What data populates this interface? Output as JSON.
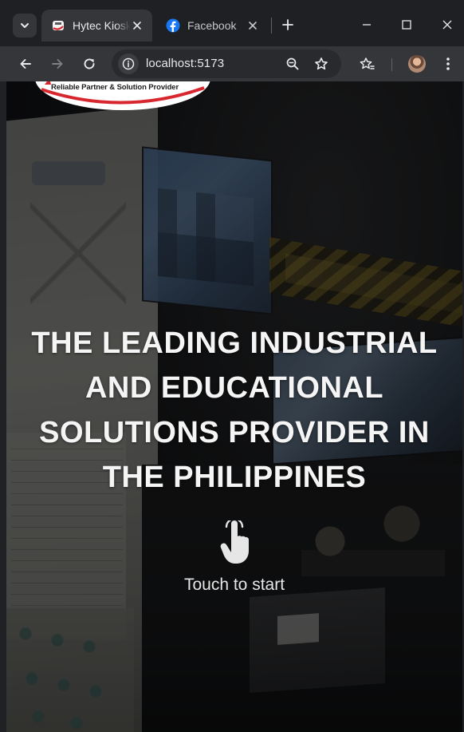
{
  "browser": {
    "tabs": [
      {
        "title": "Hytec Kiosk",
        "favicon": "hytec-favicon",
        "active": true
      },
      {
        "title": "Facebook",
        "favicon": "facebook-icon",
        "active": false
      }
    ],
    "address_bar": {
      "url": "localhost:5173"
    },
    "icons": {
      "tab_search": "chevron-down-icon",
      "tab_close": "close-icon",
      "new_tab": "plus-icon",
      "minimize": "minimize-icon",
      "maximize": "maximize-icon",
      "close_window": "close-icon",
      "back": "arrow-left-icon",
      "forward": "arrow-right-icon",
      "reload": "reload-icon",
      "site_info": "info-icon",
      "zoom": "zoom-icon",
      "bookmark": "star-icon",
      "bookmarks_menu": "bookmark-stars-icon",
      "profile": "avatar",
      "menu": "kebab-menu-icon"
    }
  },
  "kiosk": {
    "logo": {
      "tagline": "Reliable Partner & Solution Provider"
    },
    "headline_lines": [
      "THE LEADING INDUSTRIAL",
      "AND EDUCATIONAL",
      "SOLUTIONS PROVIDER IN",
      "THE PHILIPPINES"
    ],
    "cta": {
      "label": "Touch to start",
      "icon": "hand-pointer-icon"
    }
  },
  "colors": {
    "chrome_bg": "#1f2023",
    "toolbar_bg": "#35363a",
    "omnibox_bg": "#282a2d",
    "text_light": "#e8eaed",
    "logo_red": "#d7262e",
    "facebook_blue": "#1877f2",
    "headline_text": "#f5f5f5"
  }
}
